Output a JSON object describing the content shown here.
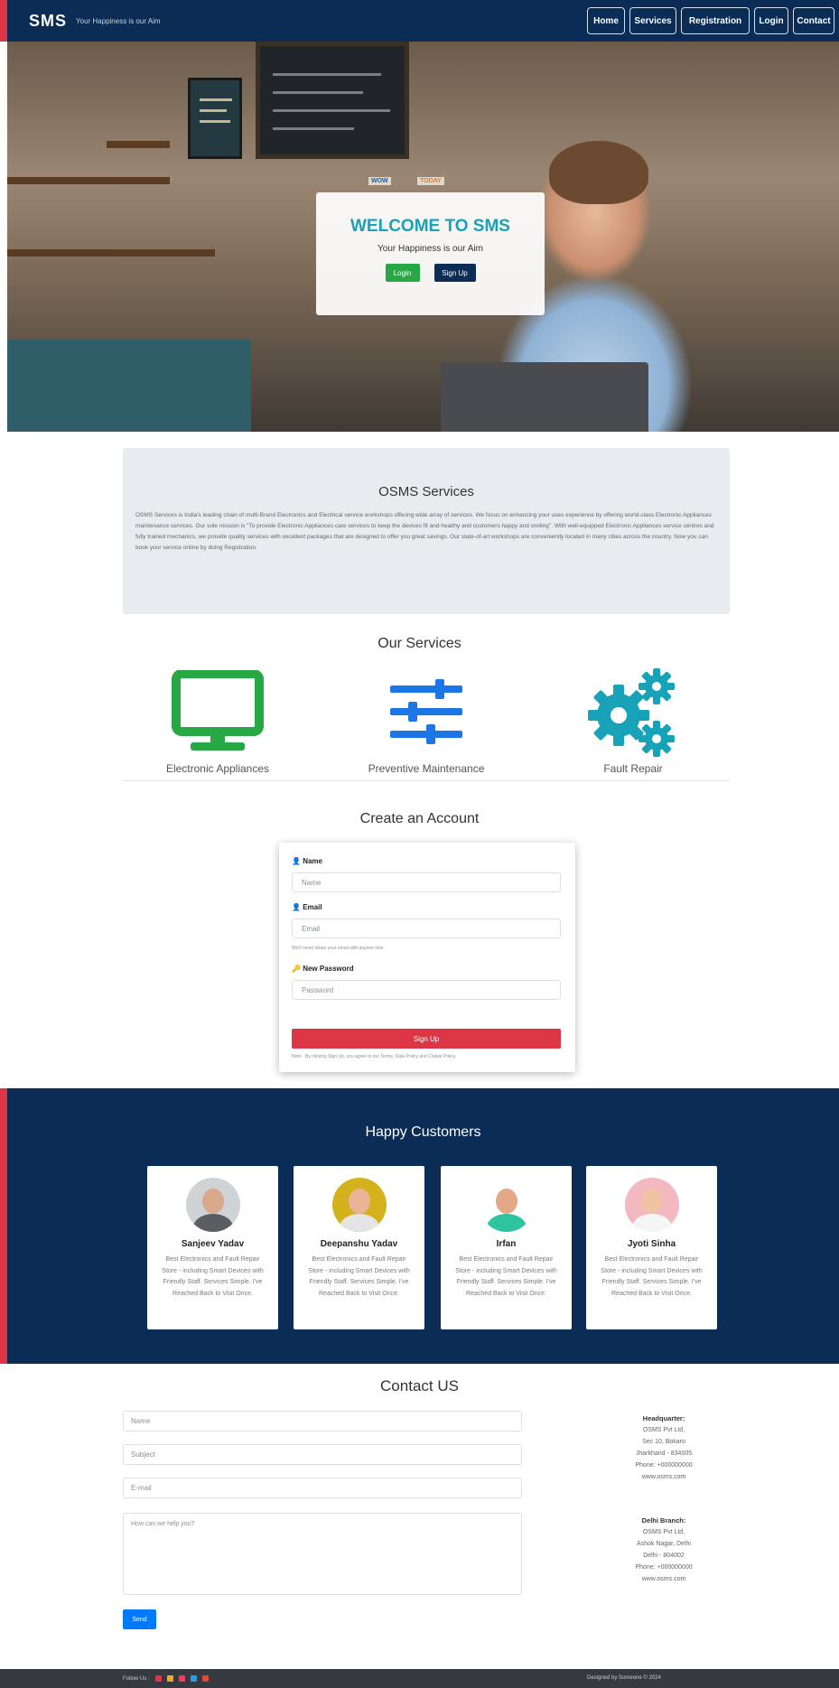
{
  "navbar": {
    "brand": "SMS",
    "tagline": "Your Happiness is our Aim",
    "items": [
      {
        "label": "Home",
        "width": 42
      },
      {
        "label": "Services",
        "width": 52
      },
      {
        "label": "Registration",
        "width": 76
      },
      {
        "label": "Login",
        "width": 38
      },
      {
        "label": "Contact",
        "width": 46
      }
    ]
  },
  "hero": {
    "tag_left": "WOW",
    "tag_right": "TODAY",
    "title": "WELCOME TO SMS",
    "subtitle": "Your Happiness is our Aim",
    "login_label": "Login",
    "signup_label": "Sign Up"
  },
  "about": {
    "title": "OSMS Services",
    "text": "OSMS Services is India's leading chain of multi-Brand Electronics and Electrical service workshops offering wide array of services. We focus on enhancing your uses experience by offering world-class Electronic Appliances maintenance services. Our sole mission is \"To provide Electronic Appliances care services to keep the devices fit and healthy and customers happy and smiling\". With well-equipped Electronic Appliances service centres and fully trained mechanics, we provide quality services with excellent packages that are designed to offer you great savings. Our state-of-art workshops are conveniently located in many cities across the country. Now you can book your service online by doing Registration."
  },
  "services": {
    "heading": "Our Services",
    "items": [
      {
        "label": "Electronic Appliances",
        "icon": "monitor-icon"
      },
      {
        "label": "Preventive Maintenance",
        "icon": "sliders-icon"
      },
      {
        "label": "Fault Repair",
        "icon": "cogs-icon"
      }
    ]
  },
  "signup_form": {
    "heading": "Create an Account",
    "name_label": "Name",
    "name_placeholder": "Name",
    "email_label": "Email",
    "email_placeholder": "Email",
    "email_help": "We'll never share your email with anyone else.",
    "password_label": "New Password",
    "password_placeholder": "Password",
    "submit_label": "Sign Up",
    "terms": "Note - By clicking Sign Up, you agree to our Terms, Data Policy and Cookie Policy."
  },
  "customers": {
    "heading": "Happy Customers",
    "items": [
      {
        "name": "Sanjeev Yadav",
        "text": "Best Electronics and Fault Repair Store - including Smart Devices with Friendly Staff. Services Simple. I've Reached Back to Visit Once.",
        "avatar_bg": "#cfd3d6",
        "skin": "#d9a98b",
        "shirt": "#5a5e62"
      },
      {
        "name": "Deepanshu Yadav",
        "text": "Best Electronics and Fault Repair Store - including Smart Devices with Friendly Staff. Services Simple. I've Reached Back to Visit Once.",
        "avatar_bg": "#d4b21e",
        "skin": "#e8b596",
        "shirt": "#e4e4e4"
      },
      {
        "name": "Irfan",
        "text": "Best Electronics and Fault Repair Store - including Smart Devices with Friendly Staff. Services Simple. I've Reached Back to Visit Once.",
        "avatar_bg": "#ffffff",
        "skin": "#e2a888",
        "shirt": "#2ec4a0"
      },
      {
        "name": "Jyoti Sinha",
        "text": "Best Electronics and Fault Repair Store - including Smart Devices with Friendly Staff. Services Simple. I've Reached Back to Visit Once.",
        "avatar_bg": "#f3b8c0",
        "skin": "#f0c3a5",
        "shirt": "#f5f5f5"
      }
    ]
  },
  "contact": {
    "heading": "Contact US",
    "name_placeholder": "Name",
    "subject_placeholder": "Subject",
    "email_placeholder": "E-mail",
    "message_placeholder": "How can we help you?",
    "send_label": "Send",
    "offices": [
      {
        "title": "Headquarter:",
        "lines": [
          "OSMS Pvt Ltd,",
          "Sec 10, Bokaro",
          "Jharkhand - 834005",
          "Phone: +000000000",
          "www.osms.com"
        ]
      },
      {
        "title": "Delhi Branch:",
        "lines": [
          "OSMS Pvt Ltd,",
          "Ashok Nagar, Delhi",
          "Delhi - 804002",
          "Phone: +000000000",
          "www.osms.com"
        ]
      }
    ]
  },
  "footer": {
    "follow_label": "Follow Us :",
    "designed_by": "Designed by Someone © 2024",
    "social_colors": [
      "#dc3545",
      "#f5a623",
      "#e4405f",
      "#1da1f2",
      "#dd4b39"
    ]
  },
  "colors": {
    "navy": "#0b2c55",
    "red": "#dc3545",
    "teal": "#17a2b8",
    "green": "#28a745",
    "blue": "#007bff"
  }
}
